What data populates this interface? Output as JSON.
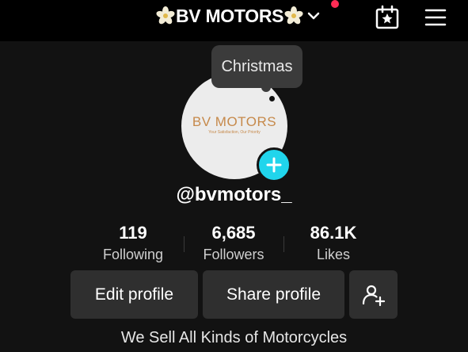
{
  "header": {
    "title": "BV MOTORS",
    "icons": [
      "flower-icon",
      "chevron-down-icon",
      "calendar-star-icon",
      "hamburger-menu-icon"
    ]
  },
  "tooltip": {
    "text": "Christmas"
  },
  "avatar": {
    "logo_text": "BV MOTORS",
    "tagline": "Your Satisfaction, Our Priority"
  },
  "profile": {
    "username": "@bvmotors_"
  },
  "stats": [
    {
      "value": "119",
      "label": "Following"
    },
    {
      "value": "6,685",
      "label": "Followers"
    },
    {
      "value": "86.1K",
      "label": "Likes"
    }
  ],
  "buttons": {
    "edit": "Edit profile",
    "share": "Share profile"
  },
  "bio": "We Sell All Kinds of Motorcycles",
  "colors": {
    "background": "#121212",
    "topbar": "#000000",
    "accent_cyan": "#20d5ec",
    "notification": "#fe2c55",
    "logo_gold": "#c6894a",
    "button": "#2f2f2f"
  }
}
